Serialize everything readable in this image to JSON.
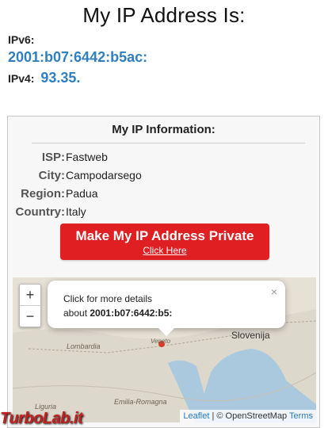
{
  "header": {
    "title": "My IP Address Is:",
    "ipv6_label": "IPv6:",
    "ipv6_value": "2001:b07:6442:b5ac:",
    "ipv4_label": "IPv4:",
    "ipv4_value": "93.35."
  },
  "info": {
    "heading": "My IP Information:",
    "rows": [
      {
        "key": "ISP:",
        "value": "Fastweb"
      },
      {
        "key": "City:",
        "value": "Campodarsego"
      },
      {
        "key": "Region:",
        "value": "Padua"
      },
      {
        "key": "Country:",
        "value": "Italy"
      }
    ],
    "cta_main": "Make My IP Address Private",
    "cta_sub": "Click Here"
  },
  "map": {
    "zoom_in": "+",
    "zoom_out": "−",
    "popup_line1": "Click for more details",
    "popup_line2_prefix": "about ",
    "popup_line2_ip": "2001:b07:6442:b5:",
    "popup_close": "×",
    "labels": [
      "Slovenija",
      "Lombardia",
      "Emilia-Romagna",
      "Liguria",
      "Veneto"
    ],
    "attrib_leaflet": "Leaflet",
    "attrib_middle": " | © OpenStreetMap ",
    "attrib_terms": "Terms"
  },
  "watermark": "TurboLab.it"
}
